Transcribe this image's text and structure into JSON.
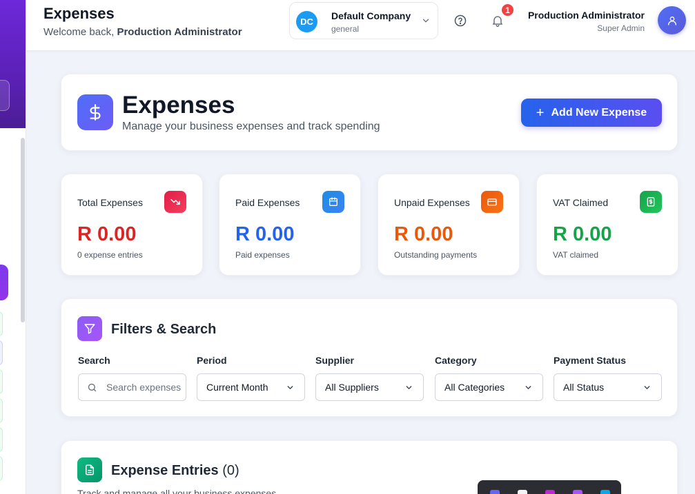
{
  "header": {
    "title": "Expenses",
    "welcome_prefix": "Welcome back, ",
    "welcome_user": "Production Administrator",
    "company": {
      "initials": "DC",
      "name": "Default Company",
      "sub": "general"
    },
    "notifications_count": "1",
    "user": {
      "name": "Production Administrator",
      "role": "Super Admin"
    }
  },
  "hero": {
    "icon": "dollar-icon",
    "title": "Expenses",
    "subtitle": "Manage your business expenses and track spending",
    "add_button": "Add New Expense"
  },
  "stats": [
    {
      "label": "Total Expenses",
      "value": "R 0.00",
      "note": "0 expense entries",
      "color": "#dc2626",
      "icon": "trending-down-icon",
      "icon_bg": "#e11d48"
    },
    {
      "label": "Paid Expenses",
      "value": "R 0.00",
      "note": "Paid expenses",
      "color": "#2563eb",
      "icon": "calendar-icon",
      "icon_bg": "#1d8ee0"
    },
    {
      "label": "Unpaid Expenses",
      "value": "R 0.00",
      "note": "Outstanding payments",
      "color": "#ea580c",
      "icon": "credit-card-icon",
      "icon_bg": "#ea580c"
    },
    {
      "label": "VAT Claimed",
      "value": "R 0.00",
      "note": "VAT claimed",
      "color": "#16a34a",
      "icon": "receipt-icon",
      "icon_bg": "#16a34a"
    }
  ],
  "filters": {
    "title": "Filters & Search",
    "search": {
      "label": "Search",
      "placeholder": "Search expenses"
    },
    "period": {
      "label": "Period",
      "value": "Current Month"
    },
    "supplier": {
      "label": "Supplier",
      "value": "All Suppliers"
    },
    "category": {
      "label": "Category",
      "value": "All Categories"
    },
    "payment_status": {
      "label": "Payment Status",
      "value": "All Status"
    }
  },
  "entries": {
    "title": "Expense Entries",
    "count": "(0)",
    "subtitle": "Track and manage all your business expenses"
  }
}
